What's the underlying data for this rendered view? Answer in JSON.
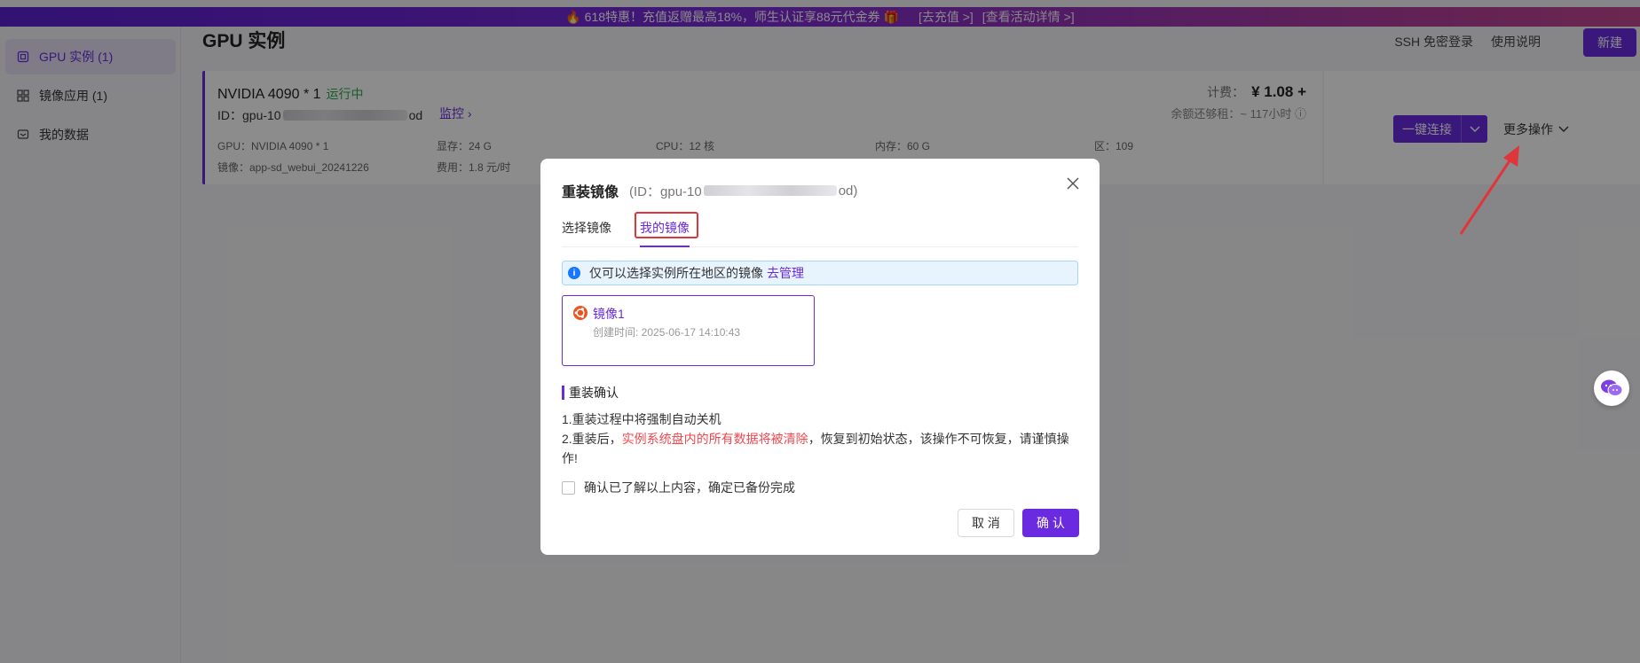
{
  "promo": {
    "text": "🔥 618特惠！充值返赠最高18%，师生认证享88元代金券 🎁",
    "recharge_link": "[去充值 >]",
    "details_link": "[查看活动详情 >]"
  },
  "sidebar": {
    "items": [
      {
        "label": "GPU 实例 (1)",
        "icon": "gpu-icon"
      },
      {
        "label": "镜像应用 (1)",
        "icon": "grid-icon"
      },
      {
        "label": "我的数据",
        "icon": "data-icon"
      }
    ]
  },
  "header": {
    "title": "GPU 实例",
    "links": [
      "SSH 免密登录",
      "使用说明"
    ],
    "new_button": "新建"
  },
  "instance": {
    "name": "NVIDIA 4090 * 1",
    "status": "运行中",
    "id_prefix": "ID：gpu-10",
    "id_suffix": "od",
    "monitor": "监控",
    "specs_row1": [
      "GPU：NVIDIA 4090 * 1",
      "显存：24 G",
      "CPU：12 核",
      "内存：60 G",
      "区：109"
    ],
    "specs_row2": [
      "镜像：app-sd_webui_20241226",
      "费用：1.8 元/时"
    ],
    "price_label": "计费：",
    "price_value": "¥ 1.08 +",
    "remain": "余额还够租：~ 117小时",
    "connect_button": "一键连接",
    "more_ops": "更多操作"
  },
  "modal": {
    "title": "重装镜像",
    "id_prefix": "(ID：gpu-10",
    "id_suffix": "od)",
    "tabs": [
      "选择镜像",
      "我的镜像"
    ],
    "info_text": "仅可以选择实例所在地区的镜像",
    "info_link": "去管理",
    "image": {
      "name": "镜像1",
      "created": "创建时间: 2025-06-17 14:10:43"
    },
    "confirm_heading": "重装确认",
    "note1": "1.重装过程中将强制自动关机",
    "note2_a": "2.重装后，",
    "note2_red": "实例系统盘内的所有数据将被清除",
    "note2_b": "，恢复到初始状态，该操作不可恢复，请谨慎操作!",
    "checkbox_label": "确认已了解以上内容，确定已备份完成",
    "cancel": "取 消",
    "ok": "确 认"
  },
  "colors": {
    "accent": "#6a2be0",
    "running": "#2fa84f",
    "danger": "#f0484f",
    "highlight": "#e0353a"
  }
}
